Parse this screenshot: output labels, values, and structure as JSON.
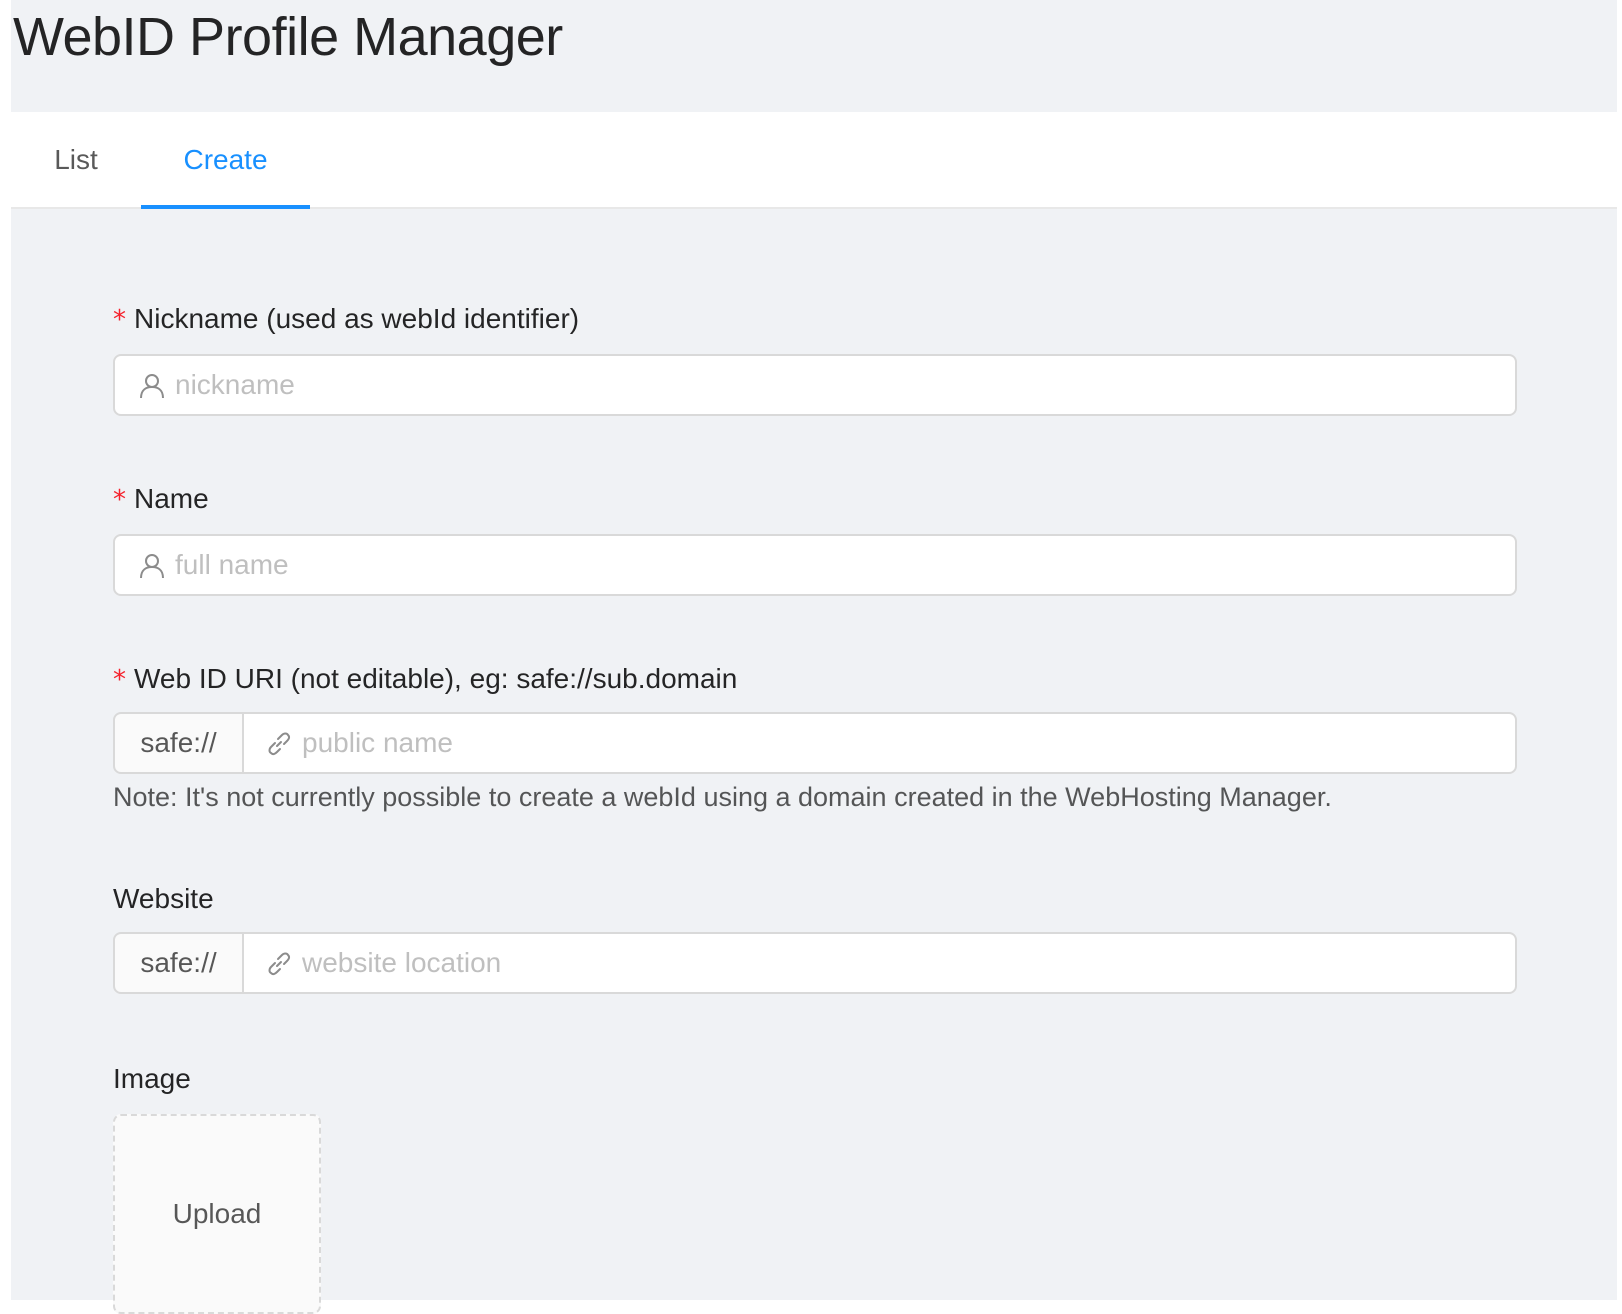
{
  "header": {
    "title": "WebID Profile Manager"
  },
  "tabs": [
    {
      "label": "List",
      "active": false
    },
    {
      "label": "Create",
      "active": true
    }
  ],
  "form": {
    "nickname": {
      "label": "Nickname (used as webId identifier)",
      "required": true,
      "placeholder": "nickname",
      "value": "",
      "icon": "user-icon"
    },
    "name": {
      "label": "Name",
      "required": true,
      "placeholder": "full name",
      "value": "",
      "icon": "user-icon"
    },
    "webid_uri": {
      "label": "Web ID URI (not editable), eg: safe://sub.domain",
      "required": true,
      "addon": "safe://",
      "placeholder": "public name",
      "value": "",
      "icon": "link-icon",
      "note": "Note: It's not currently possible to create a webId using a domain created in the WebHosting Manager."
    },
    "website": {
      "label": "Website",
      "required": false,
      "addon": "safe://",
      "placeholder": "website location",
      "value": "",
      "icon": "link-icon"
    },
    "image": {
      "label": "Image",
      "upload_label": "Upload"
    },
    "required_marker": "*"
  },
  "colors": {
    "primary": "#1890ff",
    "required": "#f5222d",
    "background": "#f0f2f5",
    "border": "#d9d9d9",
    "placeholder": "#bfbfbf"
  }
}
